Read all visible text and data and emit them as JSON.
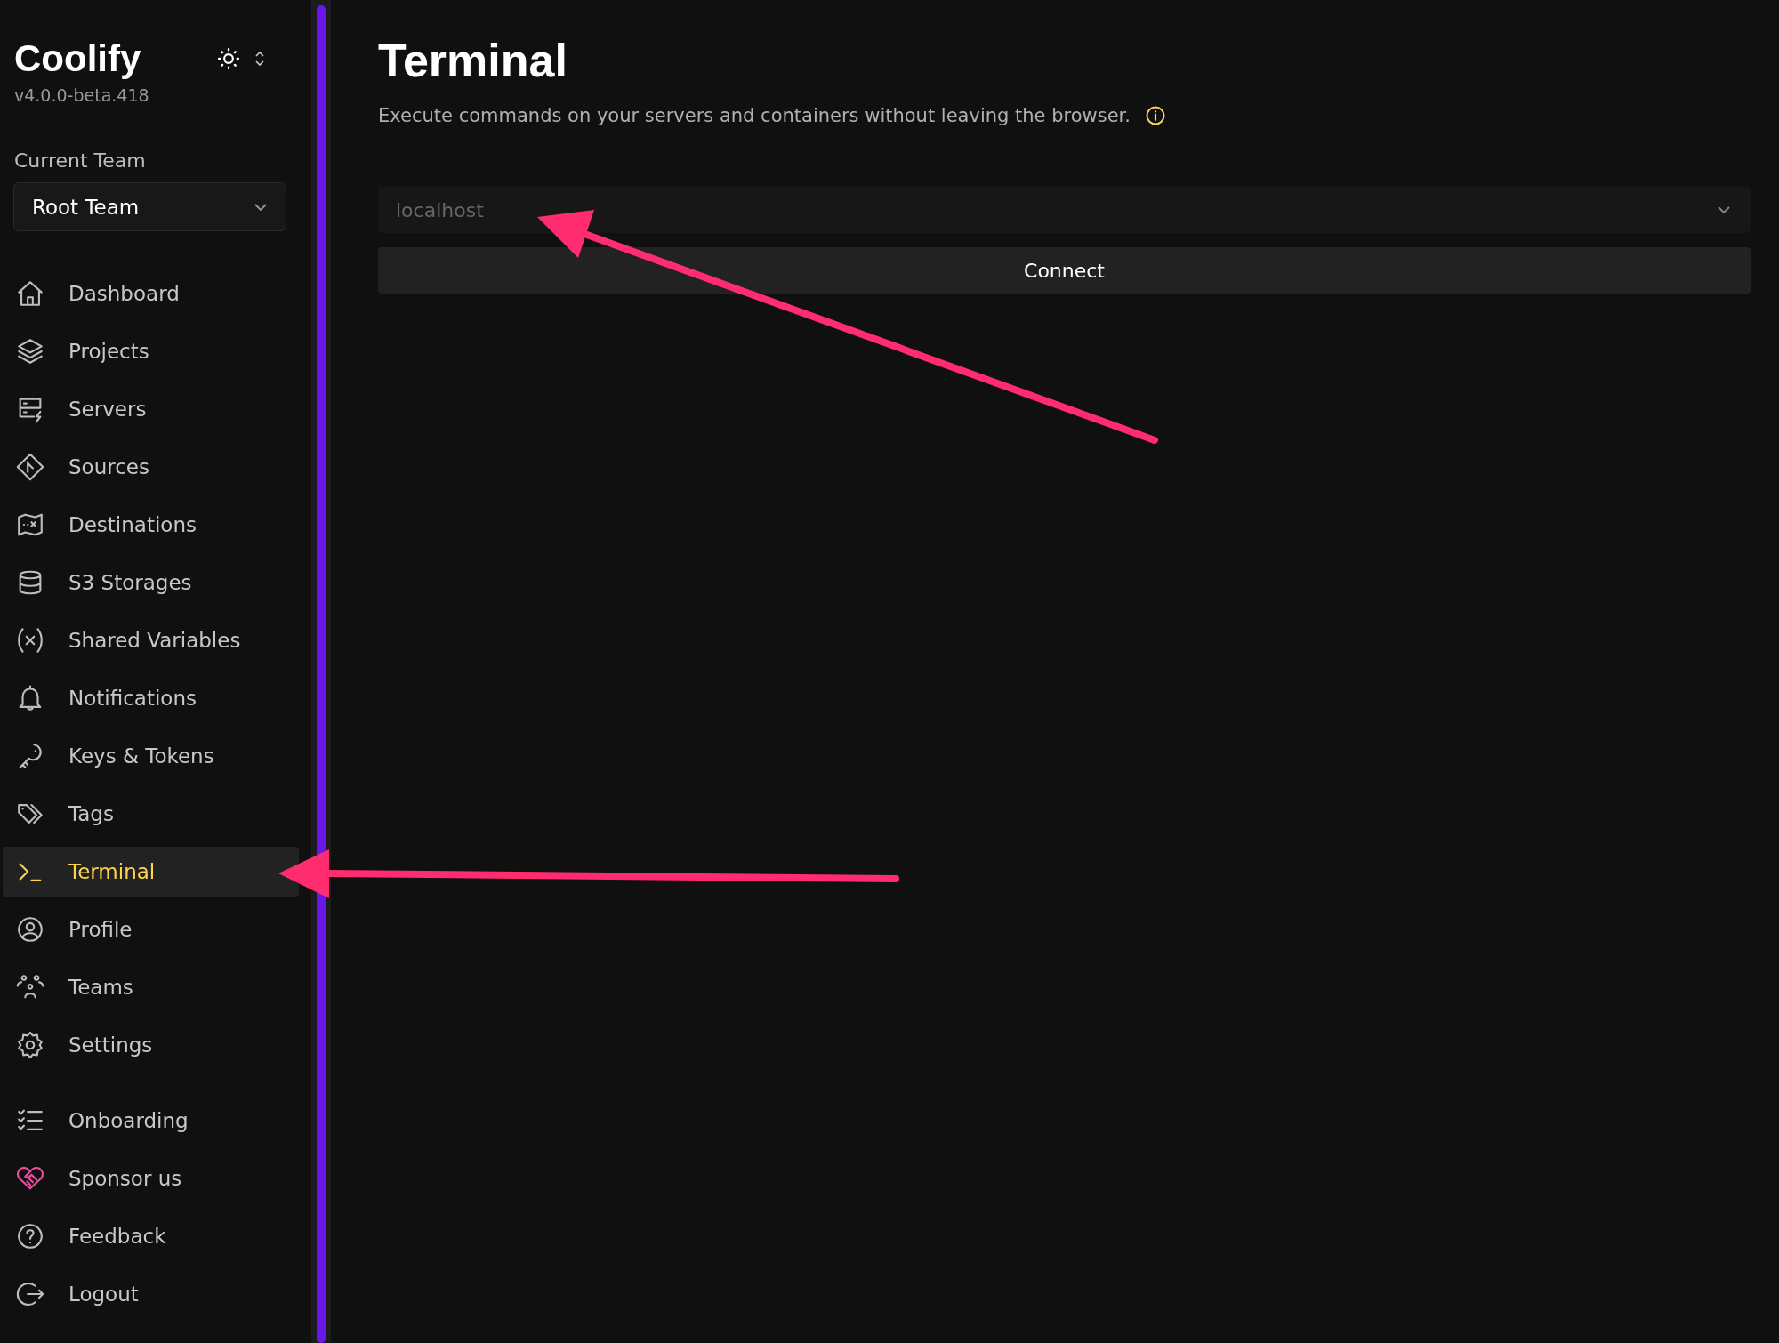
{
  "sidebar": {
    "brand": "Coolify",
    "version": "v4.0.0-beta.418",
    "team_label": "Current Team",
    "team_select": {
      "value": "Root Team"
    },
    "items": [
      {
        "label": "Dashboard",
        "selected": false
      },
      {
        "label": "Projects",
        "selected": false
      },
      {
        "label": "Servers",
        "selected": false
      },
      {
        "label": "Sources",
        "selected": false
      },
      {
        "label": "Destinations",
        "selected": false
      },
      {
        "label": "S3 Storages",
        "selected": false
      },
      {
        "label": "Shared Variables",
        "selected": false
      },
      {
        "label": "Notifications",
        "selected": false
      },
      {
        "label": "Keys & Tokens",
        "selected": false
      },
      {
        "label": "Tags",
        "selected": false
      },
      {
        "label": "Terminal",
        "selected": true
      },
      {
        "label": "Profile",
        "selected": false
      },
      {
        "label": "Teams",
        "selected": false
      },
      {
        "label": "Settings",
        "selected": false
      }
    ],
    "bottom_items": [
      {
        "label": "Onboarding"
      },
      {
        "label": "Sponsor us"
      },
      {
        "label": "Feedback"
      },
      {
        "label": "Logout"
      }
    ]
  },
  "page": {
    "title": "Terminal",
    "subtitle": "Execute commands on your servers and containers without leaving the browser.",
    "server_select": {
      "placeholder": "localhost"
    },
    "connect_button": "Connect"
  }
}
